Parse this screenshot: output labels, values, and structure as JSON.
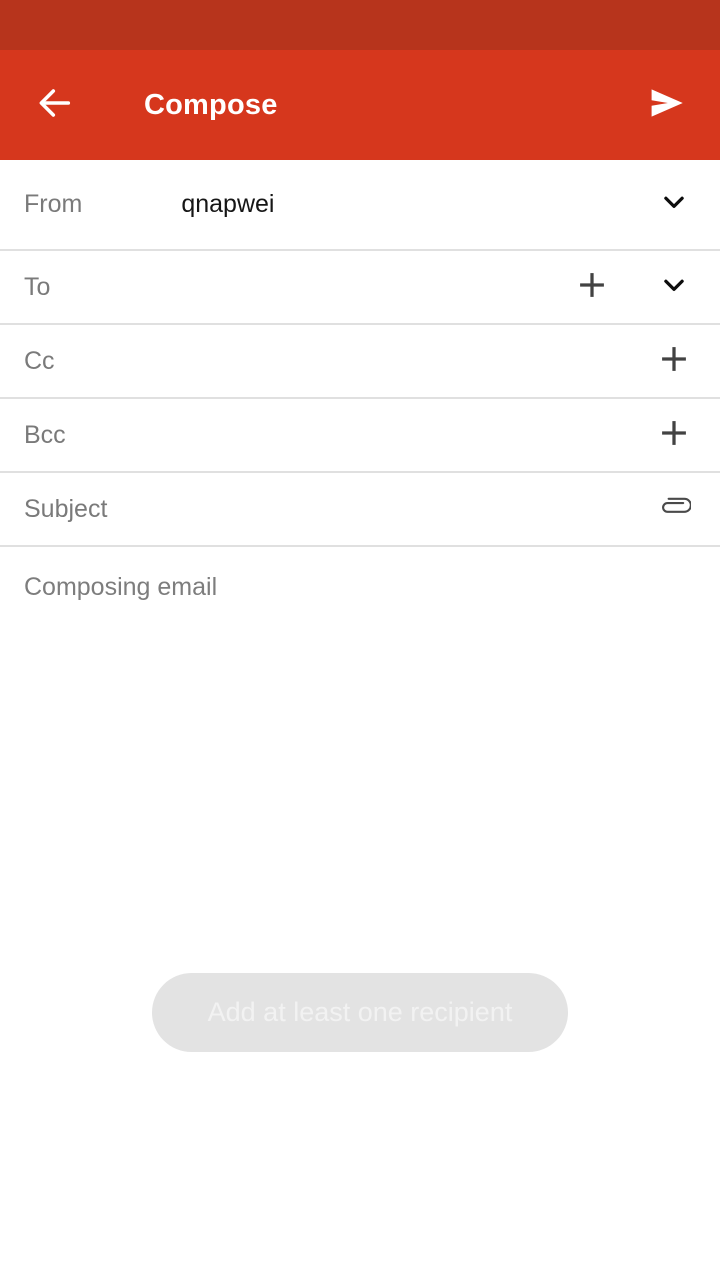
{
  "app": {
    "title": "Compose",
    "accent_color": "#d6371d",
    "status_bar_color": "#b7341c"
  },
  "app_bar": {
    "back_icon": "arrow-left-icon",
    "title": "Compose",
    "send_icon": "send-icon"
  },
  "fields": {
    "from": {
      "label": "From",
      "value": "qnapwei",
      "dropdown_icon": "chevron-down-icon"
    },
    "to": {
      "label": "To",
      "value": "",
      "placeholder": "",
      "add_icon": "plus-icon",
      "dropdown_icon": "chevron-down-icon"
    },
    "cc": {
      "label": "Cc",
      "value": "",
      "add_icon": "plus-icon"
    },
    "bcc": {
      "label": "Bcc",
      "value": "",
      "add_icon": "plus-icon"
    },
    "subject": {
      "label": "Subject",
      "value": "",
      "attach_icon": "paperclip-icon"
    }
  },
  "body": {
    "placeholder": "Composing email",
    "value": ""
  },
  "toast": {
    "message": "Add at least one recipient",
    "background_color": "#e3e3e3",
    "text_color": "#f2f2f2"
  }
}
